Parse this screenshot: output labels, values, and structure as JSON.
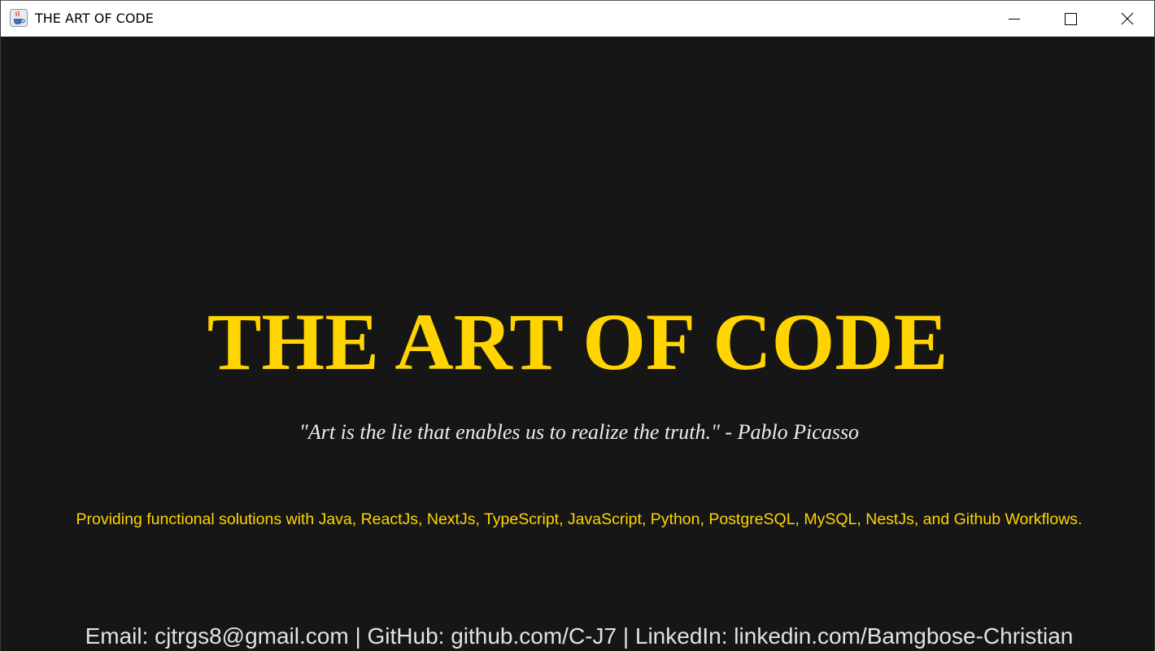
{
  "window": {
    "title": "THE ART OF CODE",
    "app_icon": "java-coffee-cup-icon",
    "controls": {
      "minimize": "minimize-icon",
      "maximize": "maximize-icon",
      "close": "close-icon"
    }
  },
  "main": {
    "headline": "THE ART OF CODE",
    "quote": "\"Art is the lie that enables us to realize the truth.\" - Pablo Picasso",
    "tagline": "Providing functional solutions with Java, ReactJs, NextJs, TypeScript, JavaScript, Python, PostgreSQL, MySQL, NestJs, and Github Workflows.",
    "contact": "Email: cjtrgs8@gmail.com | GitHub: github.com/C-J7 | LinkedIn: linkedin.com/Bamgbose-Christian"
  },
  "colors": {
    "background": "#161616",
    "accent": "#ffd400",
    "quote_text": "#ececec",
    "contact_text": "#e2e2e2",
    "titlebar": "#ffffff"
  }
}
